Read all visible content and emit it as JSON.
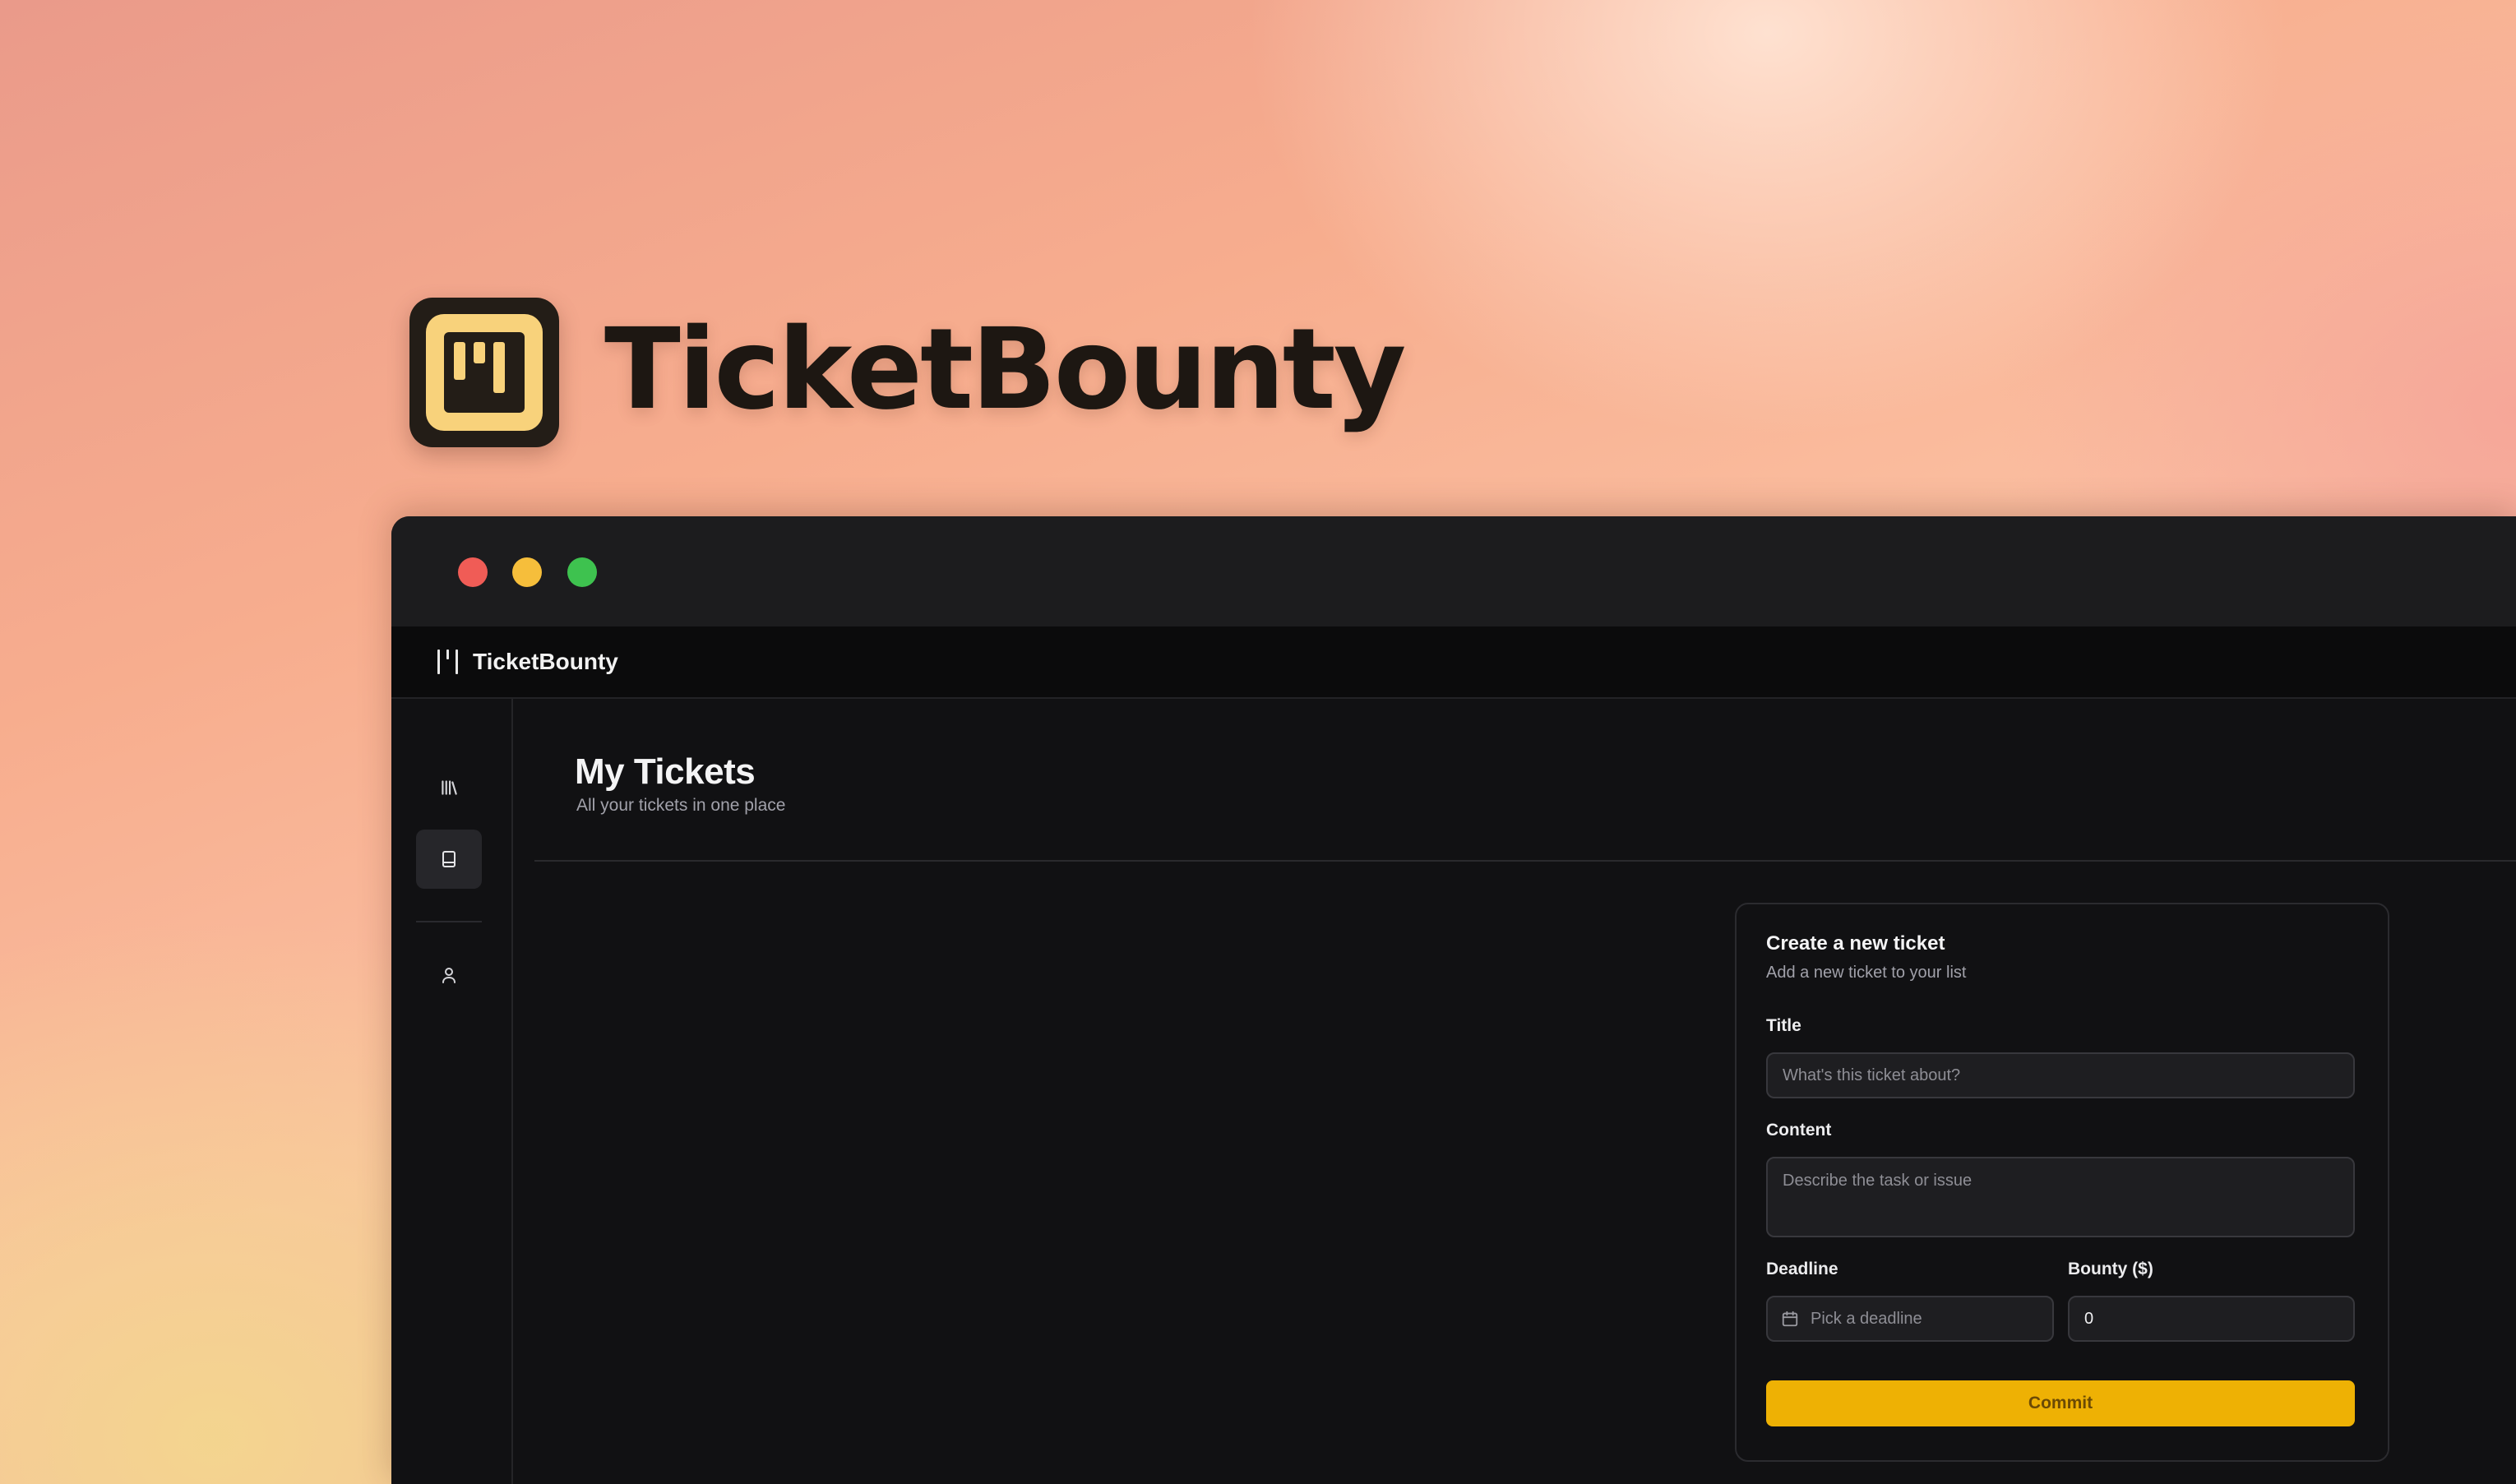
{
  "hero": {
    "title": "TicketBounty"
  },
  "window": {
    "traffic_lights": {
      "close": "#f05c56",
      "minimize": "#f6be3b",
      "zoom": "#3ec24f"
    }
  },
  "appbar": {
    "name": "TicketBounty"
  },
  "sidebar": {
    "items": [
      {
        "icon": "library-icon",
        "active": false
      },
      {
        "icon": "book-icon",
        "active": true
      },
      {
        "icon": "user-icon",
        "active": false
      }
    ]
  },
  "page": {
    "title": "My Tickets",
    "subtitle": "All your tickets in one place"
  },
  "form": {
    "title": "Create a new ticket",
    "subtitle": "Add a new ticket to your list",
    "title_label": "Title",
    "title_placeholder": "What's this ticket about?",
    "content_label": "Content",
    "content_placeholder": "Describe the task or issue",
    "deadline_label": "Deadline",
    "deadline_placeholder": "Pick a deadline",
    "bounty_label": "Bounty ($)",
    "bounty_value": "0",
    "submit_label": "Commit"
  },
  "colors": {
    "accent": "#eeb104",
    "background_dark": "#111113"
  }
}
